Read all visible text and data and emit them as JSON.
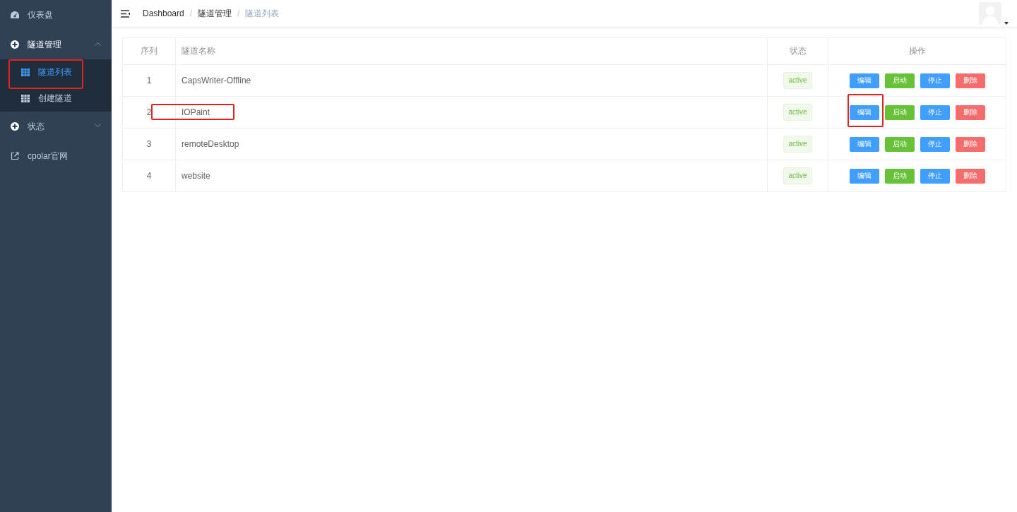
{
  "sidebar": {
    "items": [
      {
        "label": "仪表盘",
        "kind": "dashboard",
        "selected": false
      },
      {
        "label": "隧道管理",
        "kind": "group",
        "expanded": true,
        "children": [
          {
            "label": "隧道列表",
            "selected": true,
            "highlight": true
          },
          {
            "label": "创建隧道",
            "selected": false,
            "highlight": false
          }
        ]
      },
      {
        "label": "状态",
        "kind": "group",
        "expanded": false
      },
      {
        "label": "cpolar官网",
        "kind": "external",
        "selected": false
      }
    ]
  },
  "header": {
    "breadcrumb": [
      "Dashboard",
      "隧道管理",
      "隧道列表"
    ],
    "separator": "/"
  },
  "table": {
    "columns": [
      "序列",
      "隧道名称",
      "状态",
      "操作"
    ],
    "rows": [
      {
        "index": "1",
        "name": "CapsWriter-Offline",
        "name_highlight": false,
        "status": "active",
        "actions": [
          {
            "label": "编辑",
            "kind": "primary",
            "highlight": false
          },
          {
            "label": "启动",
            "kind": "success",
            "highlight": false
          },
          {
            "label": "停止",
            "kind": "primary",
            "highlight": false
          },
          {
            "label": "删除",
            "kind": "danger",
            "highlight": false
          }
        ]
      },
      {
        "index": "2",
        "name": "IOPaint",
        "name_highlight": true,
        "status": "active",
        "actions": [
          {
            "label": "编辑",
            "kind": "primary",
            "highlight": true
          },
          {
            "label": "启动",
            "kind": "success",
            "highlight": false
          },
          {
            "label": "停止",
            "kind": "primary",
            "highlight": false
          },
          {
            "label": "删除",
            "kind": "danger",
            "highlight": false
          }
        ]
      },
      {
        "index": "3",
        "name": "remoteDesktop",
        "name_highlight": false,
        "status": "active",
        "actions": [
          {
            "label": "编辑",
            "kind": "primary",
            "highlight": false
          },
          {
            "label": "启动",
            "kind": "success",
            "highlight": false
          },
          {
            "label": "停止",
            "kind": "primary",
            "highlight": false
          },
          {
            "label": "删除",
            "kind": "danger",
            "highlight": false
          }
        ]
      },
      {
        "index": "4",
        "name": "website",
        "name_highlight": false,
        "status": "active",
        "actions": [
          {
            "label": "编辑",
            "kind": "primary",
            "highlight": false
          },
          {
            "label": "启动",
            "kind": "success",
            "highlight": false
          },
          {
            "label": "停止",
            "kind": "primary",
            "highlight": false
          },
          {
            "label": "删除",
            "kind": "danger",
            "highlight": false
          }
        ]
      }
    ]
  }
}
